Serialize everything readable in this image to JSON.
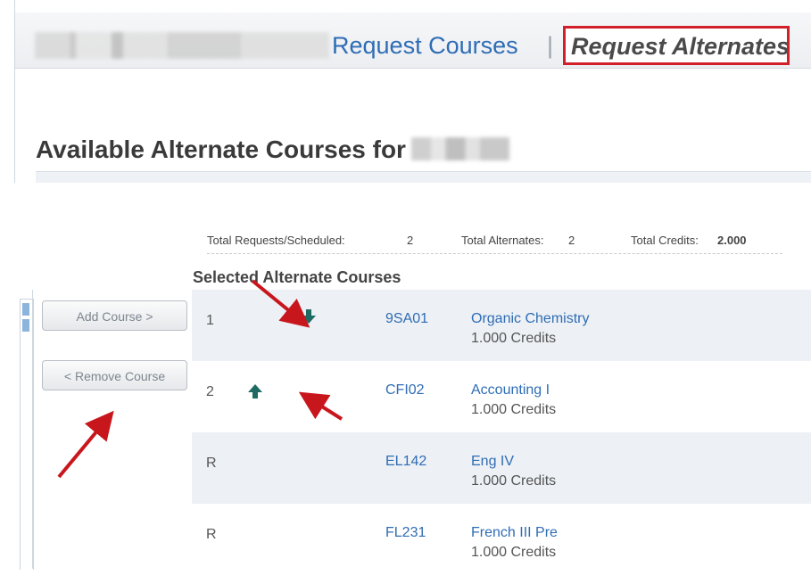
{
  "header": {
    "tabs": [
      {
        "label": "Request Courses"
      },
      {
        "label": "Request Alternates"
      }
    ],
    "separator": "|"
  },
  "page_title": "Available Alternate Courses for",
  "summary": {
    "requests_label": "Total Requests/Scheduled:",
    "requests_value": "2",
    "alternates_label": "Total Alternates:",
    "alternates_value": "2",
    "credits_label": "Total Credits:",
    "credits_value": "2.000"
  },
  "actions": {
    "add_label": "Add Course >",
    "remove_label": "< Remove Course"
  },
  "section_heading": "Selected Alternate Courses",
  "rows": [
    {
      "priority": "1",
      "code": "9SA01",
      "title": "Organic Chemistry",
      "credits": "1.000 Credits",
      "move": "down"
    },
    {
      "priority": "2",
      "code": "CFI02",
      "title": "Accounting I",
      "credits": "1.000 Credits",
      "move": "up"
    },
    {
      "priority": "R",
      "code": "EL142",
      "title": "Eng IV",
      "credits": "1.000 Credits"
    },
    {
      "priority": "R",
      "code": "FL231",
      "title": "French III Pre",
      "credits": "1.000 Credits"
    }
  ],
  "colors": {
    "link": "#2f6db5",
    "active_tab_border": "#d21f2a",
    "row_shade": "#edf0f4",
    "move_arrow": "#1f6b63",
    "annotation_arrow": "#c8161d"
  }
}
